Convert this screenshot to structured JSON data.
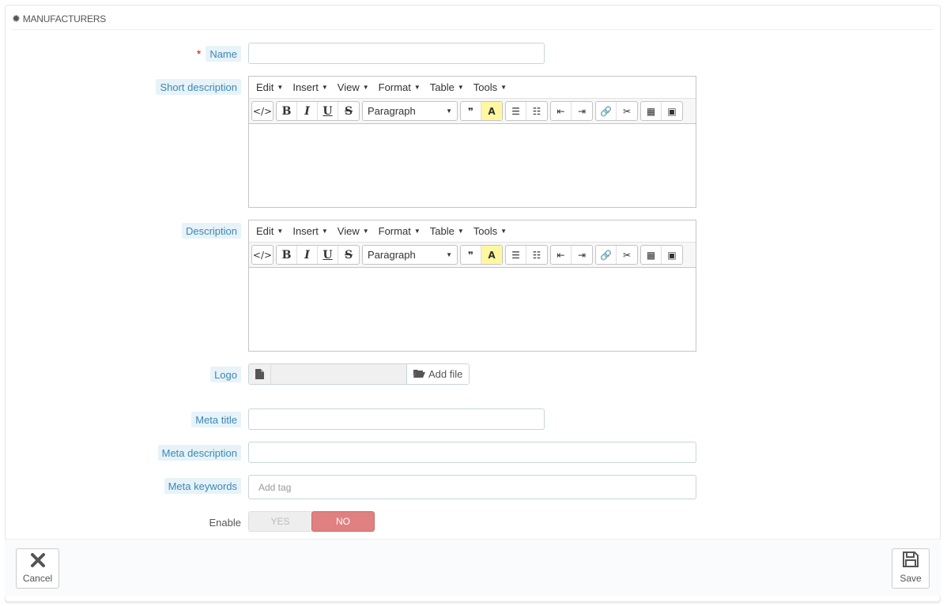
{
  "panel": {
    "title": "MANUFACTURERS",
    "icon": "gear-icon"
  },
  "fields": {
    "name": {
      "label": "Name",
      "required_mark": "*",
      "value": ""
    },
    "short_description": {
      "label": "Short description"
    },
    "description": {
      "label": "Description"
    },
    "logo": {
      "label": "Logo",
      "button": "Add file"
    },
    "meta_title": {
      "label": "Meta title",
      "value": ""
    },
    "meta_description": {
      "label": "Meta description",
      "value": ""
    },
    "meta_keywords": {
      "label": "Meta keywords",
      "placeholder": "Add tag"
    },
    "enable": {
      "label": "Enable",
      "yes": "YES",
      "no": "NO",
      "selected": "NO"
    }
  },
  "editor": {
    "menus": [
      "Edit",
      "Insert",
      "View",
      "Format",
      "Table",
      "Tools"
    ],
    "block_format": "Paragraph"
  },
  "footer": {
    "cancel": "Cancel",
    "save": "Save"
  },
  "colors": {
    "label_bg": "#e7f3f8",
    "label_text": "#3b88b5",
    "no_active": "#e08080",
    "required": "#e00000"
  }
}
